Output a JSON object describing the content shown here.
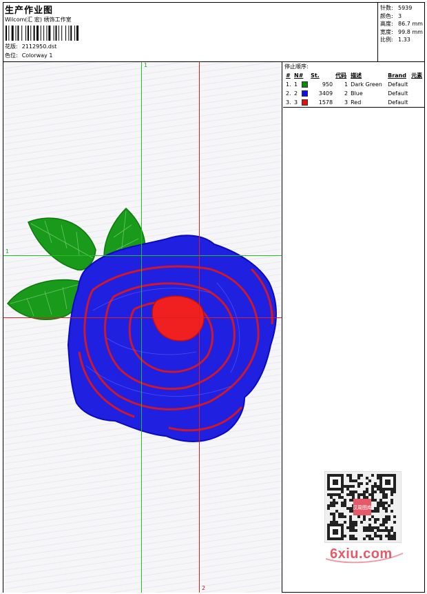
{
  "header": {
    "title": "生产作业图",
    "company": "Wilcom(汇 宏) 绣饰工作室",
    "design_label": "花版:",
    "design_file": "2112950.dst",
    "colorway_label": "色位:",
    "colorway": "Colorway 1"
  },
  "stats": [
    {
      "label": "针数:",
      "value": "5939"
    },
    {
      "label": "颜色:",
      "value": "3"
    },
    {
      "label": "高度:",
      "value": "86.7 mm"
    },
    {
      "label": "宽度:",
      "value": "99.8 mm"
    },
    {
      "label": "比例:",
      "value": "1.33"
    }
  ],
  "stop_sequence": {
    "heading": "停止顺序:",
    "columns": [
      "#",
      "N#",
      "St.",
      "代码",
      "描述",
      "Brand",
      "元素"
    ],
    "rows": [
      {
        "index": "1.",
        "n": "1",
        "color": "#0a8a0a",
        "stitches": "950",
        "code": "1",
        "desc": "Dark Green",
        "brand": "Default"
      },
      {
        "index": "2.",
        "n": "2",
        "color": "#1010e0",
        "stitches": "3409",
        "code": "2",
        "desc": "Blue",
        "brand": "Default"
      },
      {
        "index": "3.",
        "n": "3",
        "color": "#e01010",
        "stitches": "1578",
        "code": "3",
        "desc": "Red",
        "brand": "Default"
      }
    ]
  },
  "guides": {
    "green_label_top": "1",
    "green_label_left": "1",
    "red_label_right": "2",
    "red_label_bottom": "2"
  },
  "watermark": {
    "text": "6xiu.com",
    "qr_text": "汉周图库"
  },
  "colors": {
    "green_guide": "#22c022",
    "red_guide": "#e02020",
    "thread_green": "#0a8a0a",
    "thread_blue": "#1010e0",
    "thread_red": "#e01010",
    "watermark": "#e65a68"
  }
}
